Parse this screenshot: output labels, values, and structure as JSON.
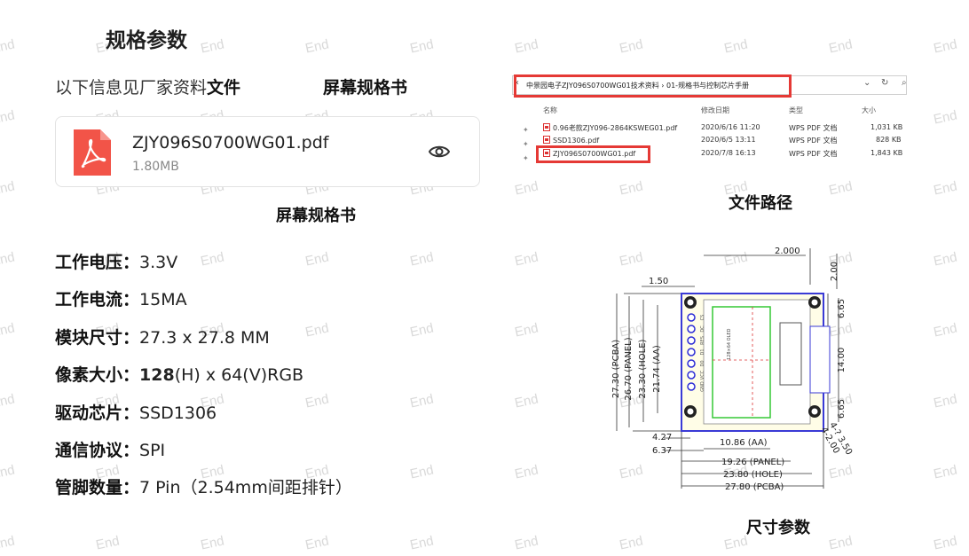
{
  "watermark": "End",
  "heading": "规格参数",
  "intro": {
    "prefix": "以下信息见厂家资料",
    "bold": "文件",
    "right": "屏幕规格书"
  },
  "file": {
    "name": "ZJY096S0700WG01.pdf",
    "size": "1.80MB",
    "icon": "pdf-icon",
    "action_icon": "eye-icon"
  },
  "file_caption": "屏幕规格书",
  "specs": [
    {
      "key": "工作电压：",
      "value": "3.3V"
    },
    {
      "key": "工作电流：",
      "value": "15MA"
    },
    {
      "key": "模块尺寸：",
      "value": "27.3 x 27.8 MM"
    },
    {
      "key": "像素大小：",
      "value_bold": "128",
      "value": "(H) x 64(V)RGB"
    },
    {
      "key": "驱动芯片：",
      "value": "SSD1306"
    },
    {
      "key": "通信协议：",
      "value": "SPI"
    },
    {
      "key": "管脚数量：",
      "value": "7 Pin（2.54mm间距排针）"
    }
  ],
  "explorer": {
    "path": "中景园电子ZJY096S0700WG01技术资料  ›  01-规格书与控制芯片手册",
    "columns": [
      "名称",
      "修改日期",
      "类型",
      "大小"
    ],
    "rows": [
      {
        "name": "0.96老款ZJY096-2864KSWEG01.pdf",
        "date": "2020/6/16 11:20",
        "type": "WPS PDF 文档",
        "size": "1,031 KB"
      },
      {
        "name": "SSD1306.pdf",
        "date": "2020/6/5 13:11",
        "type": "WPS PDF 文档",
        "size": "828 KB"
      },
      {
        "name": "ZJY096S0700WG01.pdf",
        "date": "2020/7/8 16:13",
        "type": "WPS PDF 文档",
        "size": "1,843 KB"
      }
    ]
  },
  "path_caption": "文件路径",
  "dimension_caption": "尺寸参数",
  "diagram": {
    "dims": {
      "top_hole_offset": "2.000",
      "top_right": "2.00",
      "left_top": "1.50",
      "pcba_h": "27.30 (PCBA)",
      "panel_h": "26.70 (PANEL)",
      "hole_h": "23.30 (HOLE)",
      "aa_h": "21.74 (AA)",
      "right_a": "6.65",
      "right_b": "14.00",
      "right_c": "6.65",
      "bottom_a": "4.27",
      "bottom_b": "6.37",
      "aa_w": "10.86 (AA)",
      "panel_w": "19.26 (PANEL)",
      "hole_w": "23.80 (HOLE)",
      "pcba_w": "27.80 (PCBA)",
      "hole_d1": "4-2.00",
      "hole_d2": "4-? 3.50"
    },
    "pins": [
      "GND",
      "VCC",
      "D0",
      "D1",
      "RES",
      "DC",
      "CS"
    ],
    "panel_text": "128×64 OLED"
  }
}
